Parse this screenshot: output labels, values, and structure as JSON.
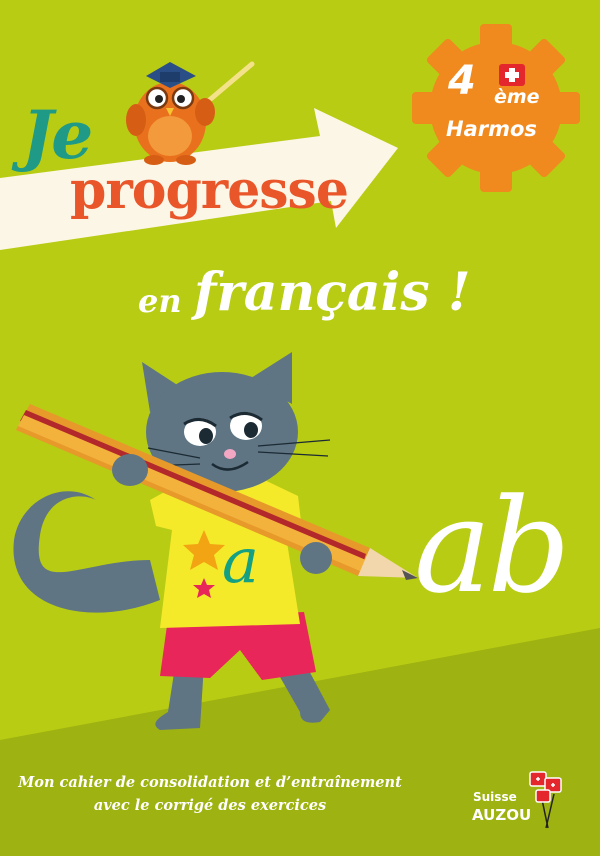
{
  "cover": {
    "title_je": "Je",
    "title_progresse": "progresse",
    "title_en": "en",
    "title_francais": "français !",
    "badge": {
      "number": "4",
      "suffix": "ème",
      "label": "Harmos"
    },
    "tagline_line1": "Mon cahier de consolidation et d’entraînement",
    "tagline_line2": "avec le corrigé des exercices",
    "publisher": {
      "region": "Suisse",
      "name": "AUZOU"
    },
    "illustration": {
      "shirt_letter": "a",
      "written_letters": "ab"
    },
    "colors": {
      "background": "#b8cc14",
      "accent_orange": "#f08a1e",
      "title_teal": "#1e9a86",
      "title_red": "#e8562a",
      "swiss_red": "#e4262d"
    },
    "icons": [
      "owl-mascot",
      "cat-mascot",
      "pencil",
      "swiss-flag-icon",
      "gear-badge"
    ]
  }
}
